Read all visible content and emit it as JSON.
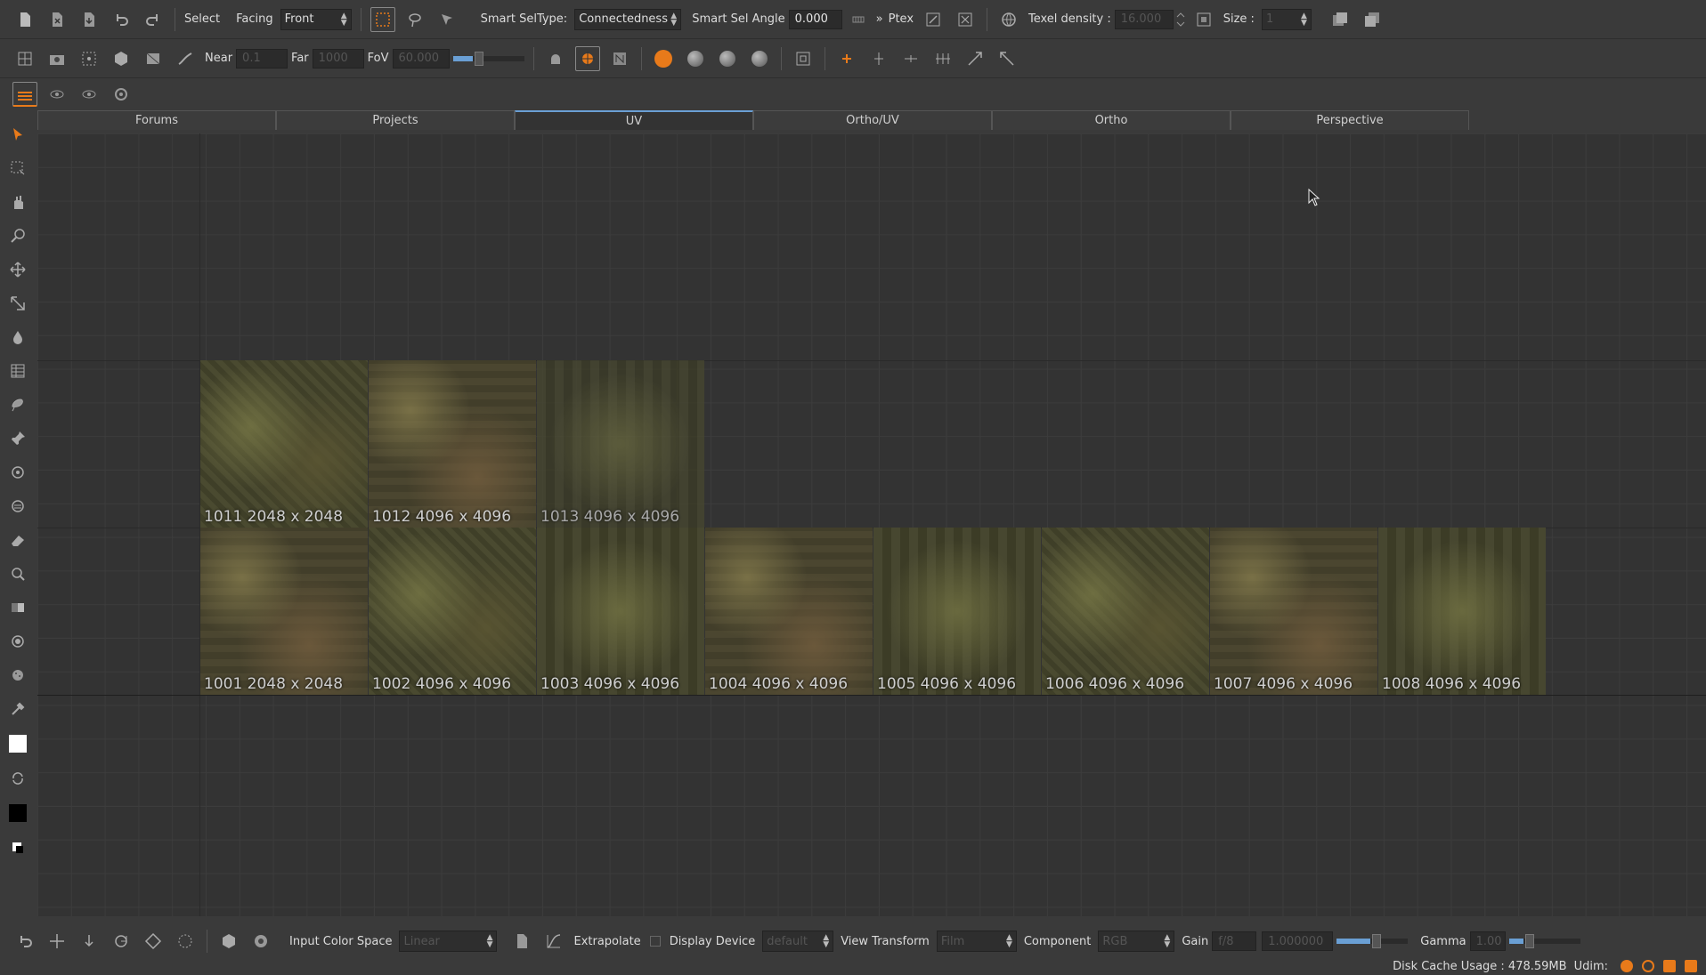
{
  "toolbar1": {
    "select_label": "Select",
    "facing_label": "Facing",
    "facing_value": "Front",
    "smart_seltype_label": "Smart SelType:",
    "smart_seltype_value": "Connectedness",
    "smart_sel_angle_label": "Smart Sel Angle",
    "smart_sel_angle_value": "0.000",
    "ptex_label": "Ptex",
    "texel_density_label": "Texel density :",
    "texel_density_value": "16.000",
    "size_label": "Size :",
    "size_value": "1"
  },
  "toolbar2": {
    "near_label": "Near",
    "near_value": "0.1",
    "far_label": "Far",
    "far_value": "1000",
    "fov_label": "FoV",
    "fov_value": "60.000"
  },
  "tabs": [
    {
      "label": "Forums"
    },
    {
      "label": "Projects"
    },
    {
      "label": "UV"
    },
    {
      "label": "Ortho/UV"
    },
    {
      "label": "Ortho"
    },
    {
      "label": "Perspective"
    }
  ],
  "active_tab": "UV",
  "tiles_row1": [
    {
      "caption": "1011 2048 x 2048"
    },
    {
      "caption": "1012 4096 x 4096"
    },
    {
      "caption": "1013 4096 x 4096"
    }
  ],
  "tiles_row2": [
    {
      "caption": "1001 2048 x 2048"
    },
    {
      "caption": "1002 4096 x 4096"
    },
    {
      "caption": "1003 4096 x 4096"
    },
    {
      "caption": "1004 4096 x 4096"
    },
    {
      "caption": "1005 4096 x 4096"
    },
    {
      "caption": "1006 4096 x 4096"
    },
    {
      "caption": "1007 4096 x 4096"
    },
    {
      "caption": "1008 4096 x 4096"
    }
  ],
  "bottom_bar": {
    "input_color_space_label": "Input Color Space",
    "input_color_space_value": "Linear",
    "extrapolate_label": "Extrapolate",
    "display_device_label": "Display Device",
    "display_device_value": "default",
    "view_transform_label": "View Transform",
    "view_transform_value": "Film",
    "component_label": "Component",
    "component_value": "RGB",
    "gain_label": "Gain",
    "gain_value": "f/8",
    "gain_number": "1.000000",
    "gamma_label": "Gamma",
    "gamma_value": "1.00"
  },
  "status": {
    "disk_cache_label": "Disk Cache Usage : 478.59MB",
    "udim_label": "Udim:"
  },
  "colors": {
    "accent_orange": "#e87a1a",
    "accent_blue": "#6a9fd4",
    "panel": "#3a3a3a",
    "viewport": "#333333"
  }
}
